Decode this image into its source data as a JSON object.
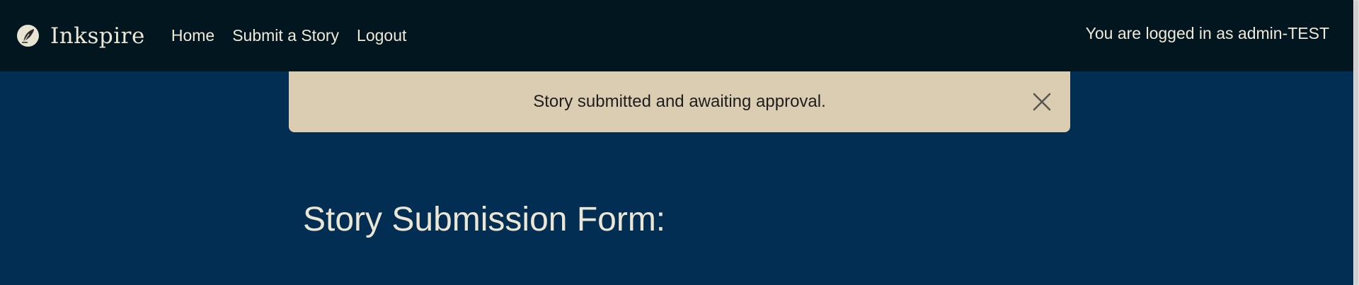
{
  "brand": {
    "name": "Inkspire",
    "logo_icon": "quill-icon"
  },
  "nav": {
    "links": [
      {
        "label": "Home"
      },
      {
        "label": "Submit a Story"
      },
      {
        "label": "Logout"
      }
    ],
    "user_status": "You are logged in as admin-TEST"
  },
  "alert": {
    "message": "Story submitted and awaiting approval.",
    "close_icon": "close-icon"
  },
  "main": {
    "title": "Story Submission Form:"
  },
  "colors": {
    "navbar_bg": "#021620",
    "page_bg": "#012e52",
    "alert_bg": "#dbcdb1",
    "text_light": "#ece6d4"
  }
}
